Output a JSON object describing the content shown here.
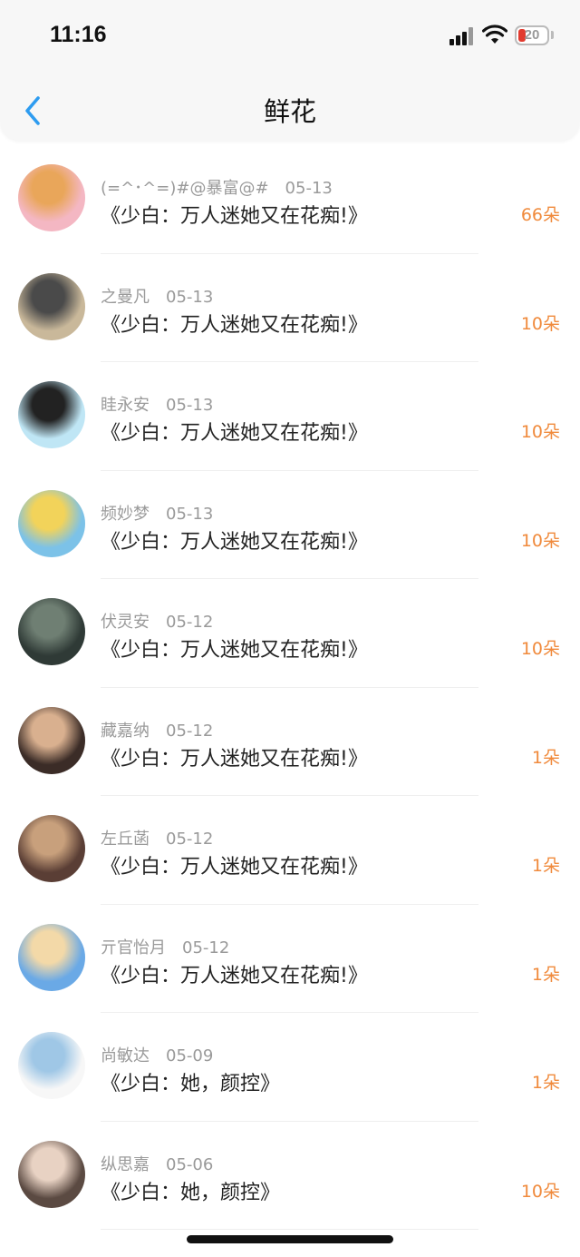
{
  "status_bar": {
    "time": "11:16",
    "battery": "20"
  },
  "header": {
    "title": "鲜花"
  },
  "rows": [
    {
      "name": "(=^･^=)#@暴富@#",
      "date": "05-13",
      "title": "《少白：万人迷她又在花痴!》",
      "count": "66朵",
      "avatar_colors": [
        "#f4b7c3",
        "#e9a65a"
      ]
    },
    {
      "name": "之曼凡",
      "date": "05-13",
      "title": "《少白：万人迷她又在花痴!》",
      "count": "10朵",
      "avatar_colors": [
        "#c9b89a",
        "#4a4a4a"
      ]
    },
    {
      "name": "眭永安",
      "date": "05-13",
      "title": "《少白：万人迷她又在花痴!》",
      "count": "10朵",
      "avatar_colors": [
        "#bfe6f5",
        "#222222"
      ]
    },
    {
      "name": "频妙梦",
      "date": "05-13",
      "title": "《少白：万人迷她又在花痴!》",
      "count": "10朵",
      "avatar_colors": [
        "#7cc2e8",
        "#f2d35a"
      ]
    },
    {
      "name": "伏灵安",
      "date": "05-12",
      "title": "《少白：万人迷她又在花痴!》",
      "count": "10朵",
      "avatar_colors": [
        "#2f3a36",
        "#6f7f73"
      ]
    },
    {
      "name": "藏嘉纳",
      "date": "05-12",
      "title": "《少白：万人迷她又在花痴!》",
      "count": "1朵",
      "avatar_colors": [
        "#3b2c27",
        "#d9b08f"
      ]
    },
    {
      "name": "左丘菡",
      "date": "05-12",
      "title": "《少白：万人迷她又在花痴!》",
      "count": "1朵",
      "avatar_colors": [
        "#5a3e35",
        "#c8a07c"
      ]
    },
    {
      "name": "亓官怡月",
      "date": "05-12",
      "title": "《少白：万人迷她又在花痴!》",
      "count": "1朵",
      "avatar_colors": [
        "#6aa9e6",
        "#f3d9a8"
      ]
    },
    {
      "name": "尚敏达",
      "date": "05-09",
      "title": "《少白：她，颜控》",
      "count": "1朵",
      "avatar_colors": [
        "#f7f7f7",
        "#9fc7e6"
      ]
    },
    {
      "name": "纵思嘉",
      "date": "05-06",
      "title": "《少白：她，颜控》",
      "count": "10朵",
      "avatar_colors": [
        "#5b4a42",
        "#e8d2c3"
      ]
    }
  ]
}
